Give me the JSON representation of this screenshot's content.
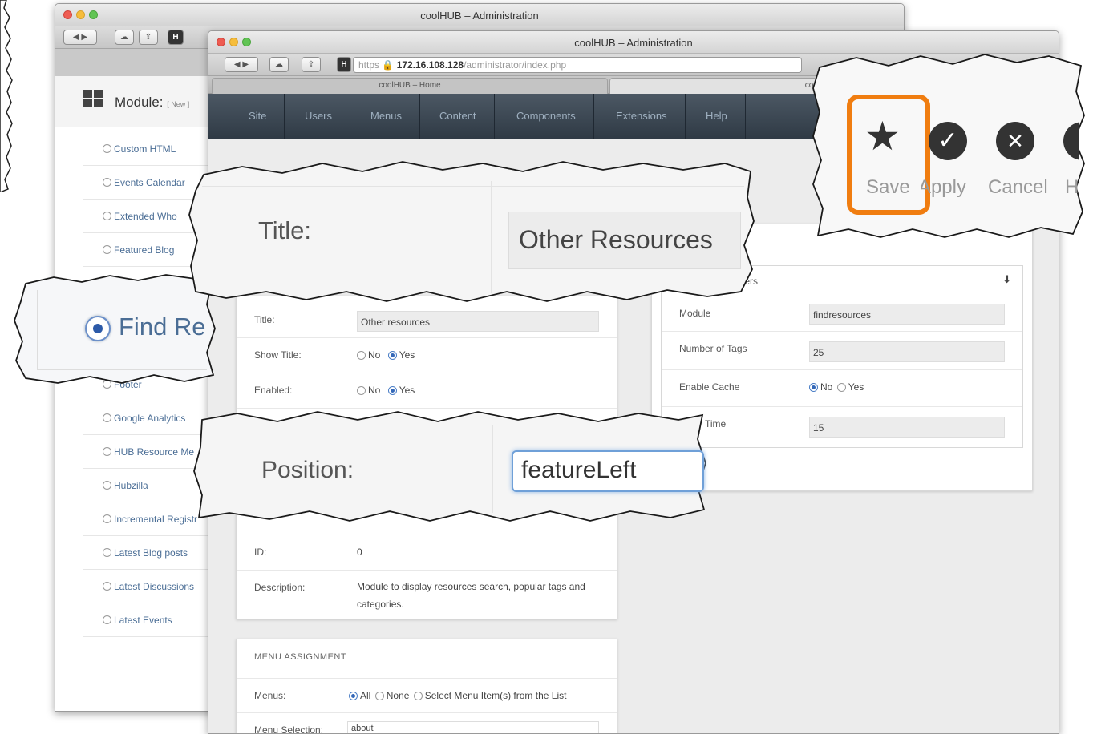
{
  "back_window": {
    "title": "coolHUB – Administration",
    "module_header": {
      "label": "Module:",
      "badge": "[ New ]"
    },
    "module_list": [
      {
        "label": "Custom HTML",
        "selected": false
      },
      {
        "label": "Events Calendar",
        "selected": false
      },
      {
        "label": "Extended Who",
        "selected": false
      },
      {
        "label": "Featured Blog",
        "selected": false
      },
      {
        "label": "",
        "selected": false
      },
      {
        "label": "",
        "selected": false
      },
      {
        "label": "Find Resources",
        "selected": true
      },
      {
        "label": "Footer",
        "selected": false
      },
      {
        "label": "Google Analytics",
        "selected": false
      },
      {
        "label": "HUB Resource Me",
        "selected": false
      },
      {
        "label": "Hubzilla",
        "selected": false
      },
      {
        "label": "Incremental Registr",
        "selected": false
      },
      {
        "label": "Latest Blog posts",
        "selected": false
      },
      {
        "label": "Latest Discussions",
        "selected": false
      },
      {
        "label": "Latest Events",
        "selected": false
      }
    ]
  },
  "front_window": {
    "title": "coolHUB – Administration",
    "url": {
      "scheme": "https",
      "host": "172.16.108.128",
      "path": "/administrator/index.php"
    },
    "tabs": [
      "coolHUB – Home",
      "coolHUB – Adm"
    ],
    "nav": [
      "Site",
      "Users",
      "Menus",
      "Content",
      "Components",
      "Extensions",
      "Help"
    ],
    "details": {
      "title_label": "Title:",
      "title_value": "Other resources",
      "show_title_label": "Show Title:",
      "enabled_label": "Enabled:",
      "no": "No",
      "yes": "Yes",
      "id_label": "ID:",
      "id_value": "0",
      "description_label": "Description:",
      "description_value": "Module to display resources search, popular tags and categories."
    },
    "menu_assignment": {
      "heading": "MENU ASSIGNMENT",
      "menus_label": "Menus:",
      "option_all": "All",
      "option_none": "None",
      "option_select": "Select Menu Item(s) from the List",
      "selection_label": "Menu Selection:",
      "selection_value": "about"
    },
    "parameters": {
      "heading": "ters",
      "module_label": "Module",
      "module_value": "findresources",
      "tags_label": "Number of Tags",
      "tags_value": "25",
      "cache_label": "Enable Cache",
      "cache_no": "No",
      "cache_yes": "Yes",
      "time_label": "Time",
      "time_value": "15"
    }
  },
  "callouts": {
    "title": {
      "label": "Title:",
      "value": "Other Resources"
    },
    "position": {
      "label": "Position:",
      "value": "featureLeft"
    },
    "find": {
      "label": "Find Re"
    },
    "toolbar": {
      "save": "Save",
      "apply": "Apply",
      "cancel": "Cancel"
    }
  },
  "colors": {
    "highlight": "#f07d10",
    "nav_dark": "#333e49",
    "link": "#4a6d95"
  }
}
